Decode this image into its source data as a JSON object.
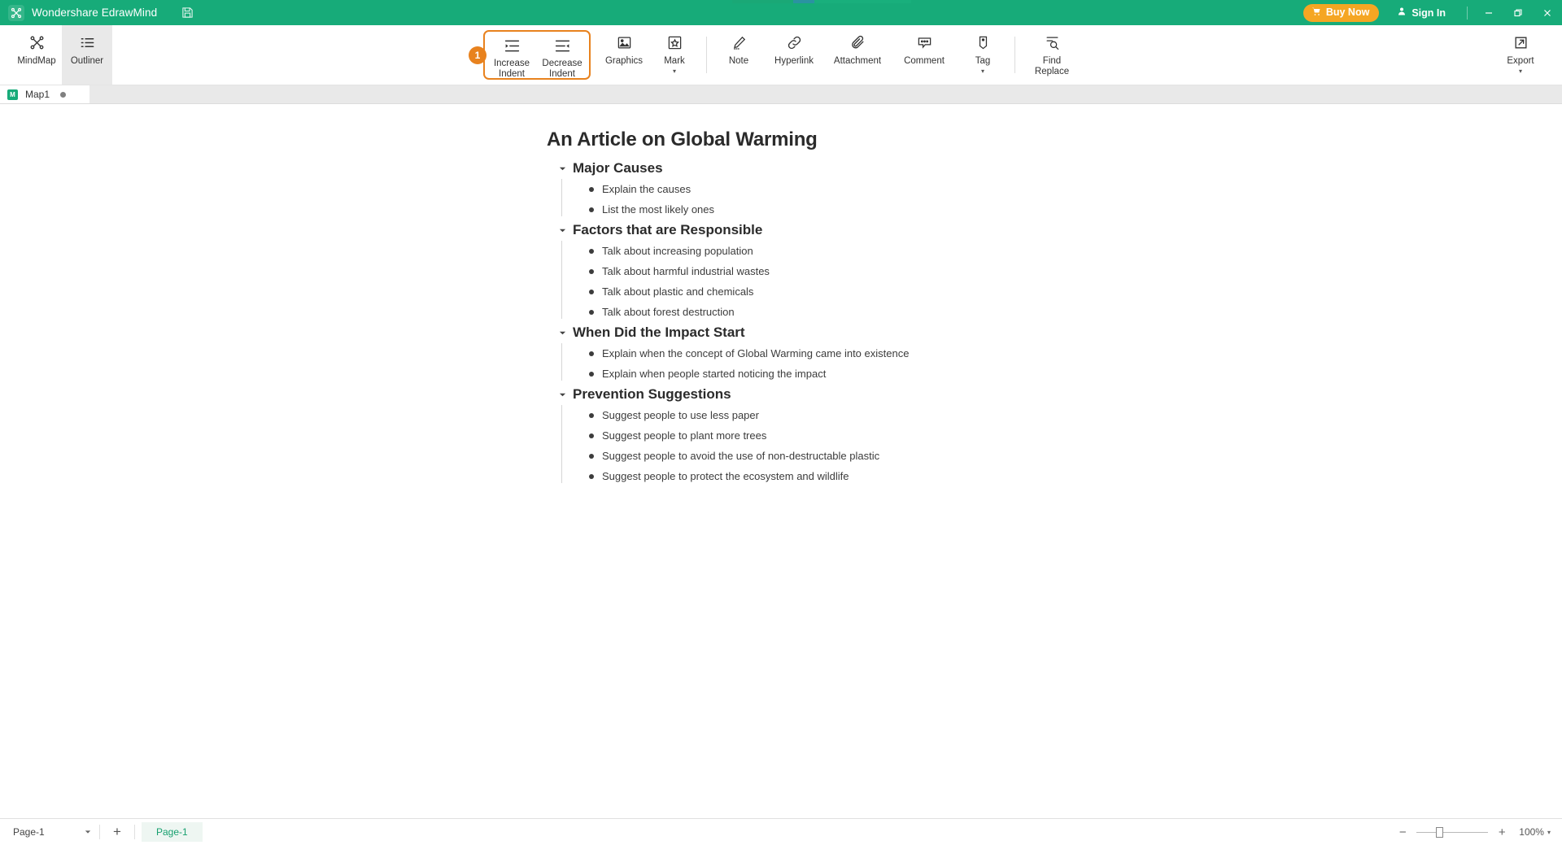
{
  "titlebar": {
    "app_name": "Wondershare EdrawMind",
    "logo_icon": "edrawmind-logo-icon",
    "save_icon": "save-icon",
    "buy_now": "Buy Now",
    "buy_now_icon": "cart-icon",
    "sign_in": "Sign In",
    "sign_in_icon": "user-icon",
    "minimize_icon": "minimize-icon",
    "restore_icon": "restore-icon",
    "close_icon": "close-icon",
    "brand_color": "#17ab79",
    "buy_now_color": "#f5a623"
  },
  "ribbon": {
    "left_items": [
      {
        "label": "MindMap",
        "icon": "mindmap-icon",
        "active": false
      },
      {
        "label": "Outliner",
        "icon": "outliner-list-icon",
        "active": true
      }
    ],
    "step_badge": "1",
    "highlight_color": "#e8821e",
    "indent_group": [
      {
        "label_line1": "Increase",
        "label_line2": "Indent",
        "icon": "increase-indent-icon"
      },
      {
        "label_line1": "Decrease",
        "label_line2": "Indent",
        "icon": "decrease-indent-icon"
      }
    ],
    "center_items": [
      {
        "label": "Graphics",
        "icon": "image-icon",
        "caret": false
      },
      {
        "label": "Mark",
        "icon": "mark-star-icon",
        "caret": true
      },
      {
        "label": "Note",
        "icon": "pencil-note-icon",
        "caret": false
      },
      {
        "label": "Hyperlink",
        "icon": "link-icon",
        "caret": false
      },
      {
        "label": "Attachment",
        "icon": "paperclip-icon",
        "caret": false
      },
      {
        "label": "Comment",
        "icon": "comment-bubble-icon",
        "caret": false
      },
      {
        "label": "Tag",
        "icon": "tag-icon",
        "caret": true
      }
    ],
    "find_replace": {
      "label_line1": "Find",
      "label_line2": "Replace",
      "icon": "find-replace-icon"
    },
    "export": {
      "label": "Export",
      "icon": "export-icon",
      "caret": true
    }
  },
  "tabstrip": {
    "tabs": [
      {
        "name": "Map1",
        "icon": "document-icon",
        "modified_dot": true
      }
    ]
  },
  "outline": {
    "title": "An Article on Global Warming",
    "sections": [
      {
        "title": "Major Causes",
        "children": [
          "Explain the causes",
          "List the most likely ones"
        ]
      },
      {
        "title": "Factors that are Responsible",
        "children": [
          "Talk about increasing population",
          "Talk about harmful industrial wastes",
          "Talk about plastic and chemicals",
          "Talk about forest destruction"
        ]
      },
      {
        "title": "When Did the Impact Start",
        "children": [
          "Explain when the concept of Global Warming came into existence",
          "Explain when people started noticing the impact"
        ]
      },
      {
        "title": "Prevention Suggestions",
        "children": [
          "Suggest people to use less paper",
          "Suggest people to plant more trees",
          "Suggest people to avoid the use of non-destructable plastic",
          "Suggest people to protect the ecosystem and wildlife"
        ]
      }
    ]
  },
  "statusbar": {
    "page_selector_value": "Page-1",
    "add_page_label": "+",
    "page_chip_label": "Page-1",
    "page_chip_color": "#17a06f",
    "zoom_out_label": "−",
    "zoom_in_label": "+",
    "zoom_percent": "100%"
  }
}
